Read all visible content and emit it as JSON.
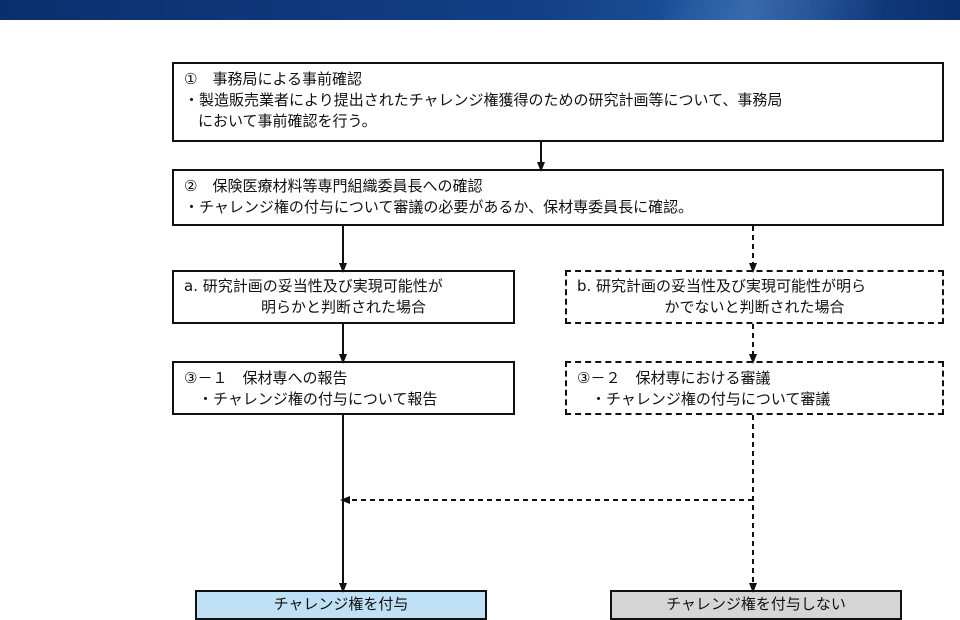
{
  "diagram": {
    "box1": {
      "title": "①　事務局による事前確認",
      "line2": "・製造販売業者により提出されたチャレンジ権獲得のための研究計画等について、事務局",
      "line3": "において事前確認を行う。"
    },
    "box2": {
      "title": "②　保険医療材料等専門組織委員長への確認",
      "line2": "・チャレンジ権の付与について審議の必要があるか、保材専委員長に確認。"
    },
    "boxA": {
      "line1": "a. 研究計画の妥当性及び実現可能性が",
      "line2": "明らかと判断された場合"
    },
    "boxB": {
      "line1": "b. 研究計画の妥当性及び実現可能性が明ら",
      "line2": "かでないと判断された場合"
    },
    "box31": {
      "title": "③－１　保材専への報告",
      "line2": "・チャレンジ権の付与について報告"
    },
    "box32": {
      "title": "③－２　保材専における審議",
      "line2": "・チャレンジ権の付与について審議"
    },
    "results": {
      "grant": "チャレンジ権を付与",
      "deny": "チャレンジ権を付与しない"
    }
  },
  "colors": {
    "banner": "#0a2f6e",
    "grant_fill": "#bfe0f5",
    "deny_fill": "#d6d6d6",
    "line": "#111111"
  }
}
